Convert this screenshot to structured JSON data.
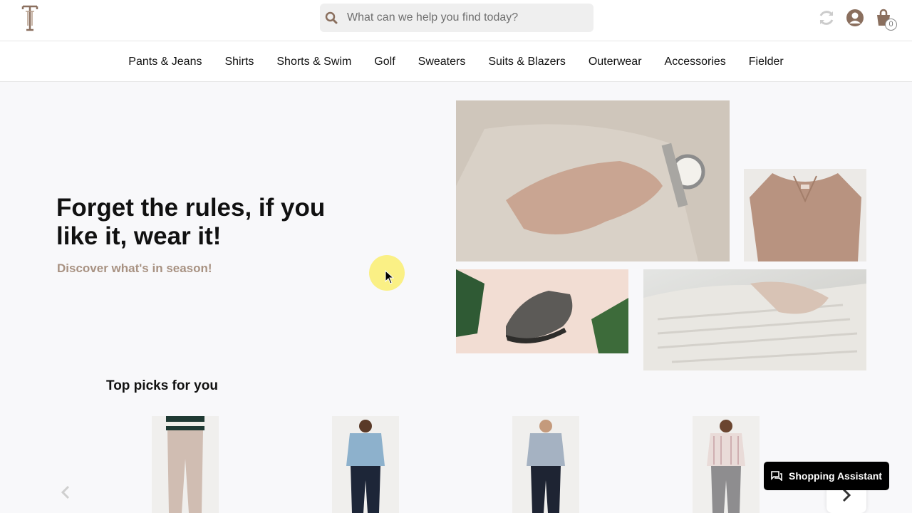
{
  "header": {
    "search_placeholder": "What can we help you find today?",
    "cart_count": "0"
  },
  "nav": {
    "items": [
      "Pants & Jeans",
      "Shirts",
      "Shorts & Swim",
      "Golf",
      "Sweaters",
      "Suits & Blazers",
      "Outerwear",
      "Accessories",
      "Fielder"
    ]
  },
  "hero": {
    "title": "Forget the rules, if you like it, wear it!",
    "subtitle": "Discover what's in season!"
  },
  "picks": {
    "title": "Top picks for you"
  },
  "assistant": {
    "label": "Shopping Assistant"
  },
  "colors": {
    "accent": "#a89282",
    "brand": "#8a6f5e"
  },
  "icons": [
    "logo-icon",
    "search-icon",
    "refresh-icon",
    "account-icon",
    "cart-icon",
    "chevron-left-icon",
    "chevron-right-icon",
    "chat-icon"
  ]
}
